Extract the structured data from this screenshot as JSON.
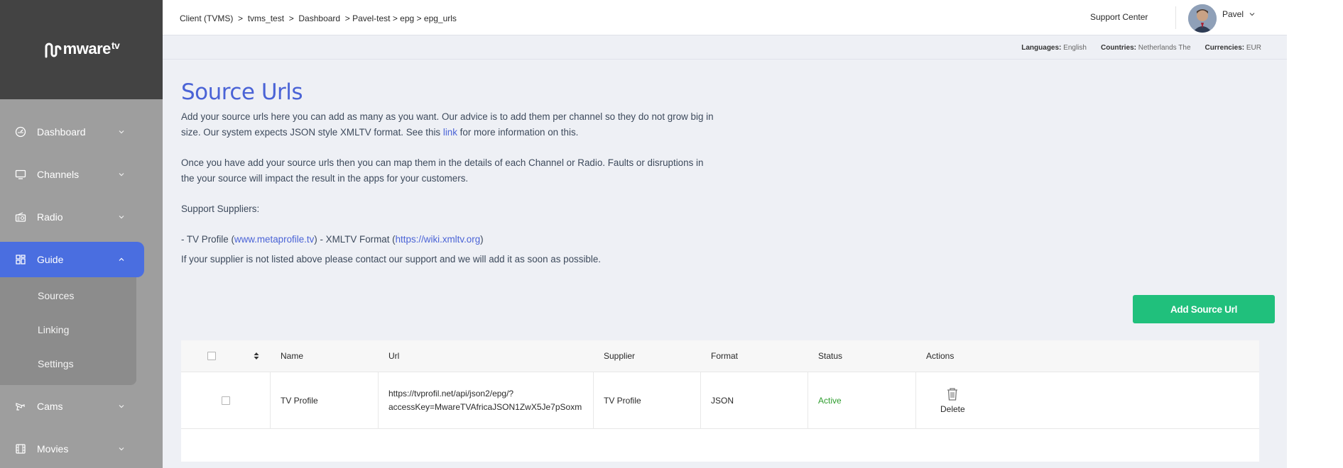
{
  "brand": {
    "name": "mware",
    "suffix": "tv"
  },
  "sidebar": {
    "items": [
      {
        "label": "Dashboard"
      },
      {
        "label": "Channels"
      },
      {
        "label": "Radio"
      },
      {
        "label": "Guide"
      },
      {
        "label": "Cams"
      },
      {
        "label": "Movies"
      }
    ],
    "guide_submenu": [
      {
        "label": "Sources"
      },
      {
        "label": "Linking"
      },
      {
        "label": "Settings"
      }
    ]
  },
  "topbar": {
    "breadcrumb": [
      "Client (TVMS)",
      "  >  ",
      "tvms_test",
      "  >  ",
      "Dashboard",
      "  > ",
      "Pavel-test",
      " > ",
      "epg",
      " > ",
      "epg_urls"
    ],
    "support_label": "Support Center",
    "user_name": "Pavel"
  },
  "locale": {
    "languages_label": "Languages:",
    "languages_value": "English",
    "countries_label": "Countries:",
    "countries_value": "Netherlands The",
    "currencies_label": "Currencies:",
    "currencies_value": "EUR"
  },
  "page": {
    "title": "Source Urls",
    "p1_a": "Add your source urls here you can add as many as you want. Our advice is to add them per channel so they do not grow big in size. Our system expects JSON style XMLTV format. See this ",
    "p1_link": "link",
    "p1_b": " for more information on this.",
    "p2": "Once you have add your source urls then you can map them in the details of each Channel or Radio. Faults or disruptions in the your source will impact the result in the apps for your customers.",
    "p3": "Support Suppliers:",
    "p4_a": "- TV Profile (",
    "p4_link1": "www.metaprofile.tv",
    "p4_b": ") - XMLTV Format (",
    "p4_link2": "https://wiki.xmltv.org",
    "p4_c": ")",
    "p5": "If your supplier is not listed above please contact our support and we will add it as soon as possible.",
    "add_button": "Add Source Url"
  },
  "table": {
    "headers": {
      "name": "Name",
      "url": "Url",
      "supplier": "Supplier",
      "format": "Format",
      "status": "Status",
      "actions": "Actions"
    },
    "rows": [
      {
        "name": "TV Profile",
        "url_line1": "https://tvprofil.net/api/json2/epg/?",
        "url_line2": "accessKey=MwareTVAfricaJSON1ZwX5Je7pSoxm",
        "supplier": "TV Profile",
        "format": "JSON",
        "status": "Active",
        "action_label": "Delete"
      }
    ]
  },
  "colors": {
    "accent": "#4a63d6",
    "active_nav": "#4a6ee0",
    "add_button": "#20c07c",
    "status_active": "#2e9d2e"
  }
}
